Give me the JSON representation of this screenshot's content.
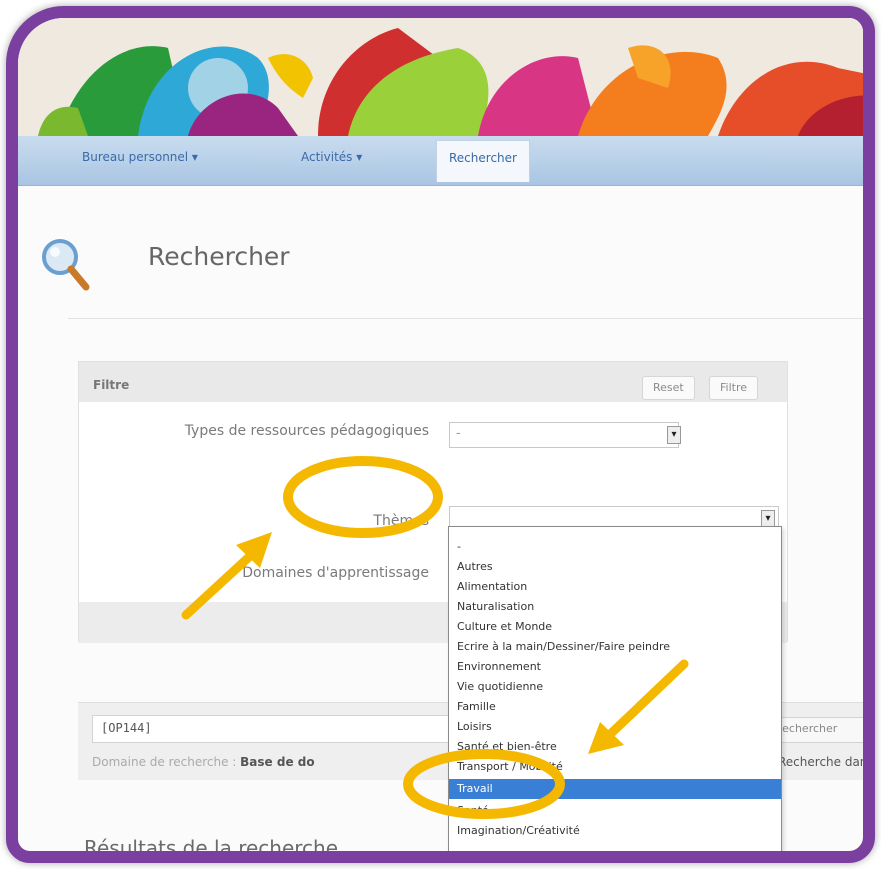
{
  "nav": {
    "items": [
      {
        "label": "Bureau personnel ▾"
      },
      {
        "label": "Activités ▾"
      },
      {
        "label": "Rechercher"
      }
    ]
  },
  "page": {
    "title": "Rechercher"
  },
  "filter": {
    "heading": "Filtre",
    "reset_label": "Reset",
    "filter_label": "Filtre",
    "fields": {
      "resource_types_label": "Types de ressources pédagogiques",
      "resource_types_value": "-",
      "themes_label": "Thèmes",
      "themes_value": "",
      "domains_label": "Domaines d'apprentissage"
    }
  },
  "themes_dropdown": {
    "options": [
      "-",
      "Autres",
      "Alimentation",
      "Naturalisation",
      "Culture et Monde",
      "Ecrire à la main/Dessiner/Faire peindre",
      "Environnement",
      "Vie quotidienne",
      "Famille",
      "Loisirs",
      "Santé et bien-être",
      "Transport / Mobilité",
      "Travail",
      "Santé",
      "Imagination/Créativité"
    ],
    "selected_index": 12
  },
  "query": {
    "value": "[OP144]",
    "search_button": "Rechercher",
    "domain_label": "Domaine de recherche :",
    "domain_value": "Base de do",
    "domain_right": "Recherche dans"
  },
  "results": {
    "title": "Résultats de la recherche"
  },
  "colors": {
    "frame": "#7b3fa0",
    "navbar": "#b9d0ea",
    "highlight": "#3a7fd6",
    "annotation": "#f5b800"
  },
  "icons": {
    "search": "magnifier-icon",
    "select_arrow": "chevron-down-icon"
  }
}
